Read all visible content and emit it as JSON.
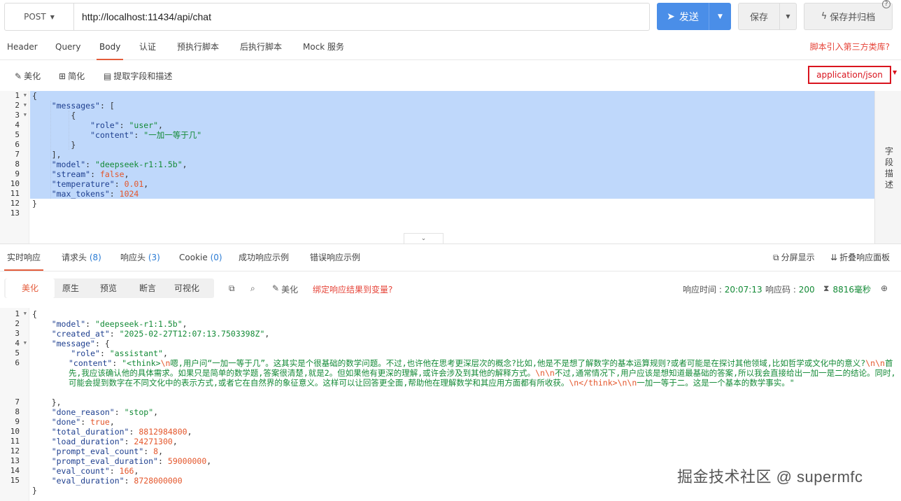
{
  "topbar": {
    "method": "POST",
    "url": "http://localhost:11434/api/chat",
    "send_label": "发送",
    "save_label": "保存",
    "save_archive_label": "保存并归档",
    "help": "?"
  },
  "request_tabs": [
    "Header",
    "Query",
    "Body",
    "认证",
    "预执行脚本",
    "后执行脚本",
    "Mock 服务"
  ],
  "active_request_tab": "Body",
  "third_party_link": "脚本引入第三方类库?",
  "body_tools": {
    "beautify": "美化",
    "simplify": "简化",
    "extract": "提取字段和描述",
    "content_type": "application/json"
  },
  "side_panel_label": "字段描述",
  "request_line_numbers": [
    "1",
    "2",
    "3",
    "4",
    "5",
    "6",
    "7",
    "8",
    "9",
    "10",
    "11",
    "12",
    "13"
  ],
  "request_body": {
    "role_key": "\"role\"",
    "role_val": "\"user\"",
    "content_key": "\"content\"",
    "content_val": "\"一加一等于几\"",
    "messages_key": "\"messages\"",
    "model_key": "\"model\"",
    "model_val": "\"deepseek-r1:1.5b\"",
    "stream_key": "\"stream\"",
    "stream_val": "false",
    "temperature_key": "\"temperature\"",
    "temperature_val": "0.01",
    "max_tokens_key": "\"max_tokens\"",
    "max_tokens_val": "1024"
  },
  "response_tabs": {
    "realtime": "实时响应",
    "req_headers": "请求头",
    "req_headers_count": "(8)",
    "resp_headers": "响应头",
    "resp_headers_count": "(3)",
    "cookie": "Cookie",
    "cookie_count": "(0)",
    "success_example": "成功响应示例",
    "error_example": "错误响应示例",
    "split_view": "分屏显示",
    "fold_panel": "折叠响应面板"
  },
  "response_tools": {
    "segments": [
      "美化",
      "原生",
      "预览",
      "断言",
      "可视化"
    ],
    "active_segment": "美化",
    "beautify": "美化",
    "bind_var": "绑定响应结果到变量?",
    "time_label": "响应时间 : ",
    "time_value": "20:07:13",
    "code_label": "响应码 : ",
    "code_value": "200",
    "duration": "8816毫秒"
  },
  "response_line_numbers": [
    "1",
    "2",
    "3",
    "4",
    "5",
    "6",
    "7",
    "8",
    "9",
    "10",
    "11",
    "12",
    "13",
    "14",
    "15"
  ],
  "response_body": {
    "model_key": "\"model\"",
    "model_val": "\"deepseek-r1:1.5b\"",
    "created_key": "\"created_at\"",
    "created_val": "\"2025-02-27T12:07:13.7503398Z\"",
    "message_key": "\"message\"",
    "role_key": "\"role\"",
    "role_val": "\"assistant\"",
    "content_key": "\"content\"",
    "content_p1": "\"<think>",
    "content_e1": "\\n",
    "content_p2": "嗯,用户问“一加一等于几”。这其实是个很基础的数学问题。不过,也许他在思考更深层次的概念?比如,他是不是想了解数字的基本运算规则?或者可能是在探讨其他领域,比如哲学或文化中的意义?",
    "content_e2": "\\n\\n",
    "content_p3": "首先,我应该确认他的具体需求。如果只是简单的数学题,答案很清楚,就是2。但如果他有更深的理解,或许会涉及到其他的解释方式。",
    "content_e3": "\\n\\n",
    "content_p4": "不过,通常情况下,用户应该是想知道最基础的答案,所以我会直接给出一加一是二的结论。同时,可能会提到数字在不同文化中的表示方式,或者它在自然界的象征意义。这样可以让回答更全面,帮助他在理解数学和其应用方面都有所收获。",
    "content_e4": "\\n</think>\\n\\n",
    "content_p5": "一加一等于二。这是一个基本的数学事实。\"",
    "done_reason_key": "\"done_reason\"",
    "done_reason_val": "\"stop\"",
    "done_key": "\"done\"",
    "done_val": "true",
    "total_duration_key": "\"total_duration\"",
    "total_duration_val": "8812984800",
    "load_duration_key": "\"load_duration\"",
    "load_duration_val": "24271300",
    "prompt_eval_count_key": "\"prompt_eval_count\"",
    "prompt_eval_count_val": "8",
    "prompt_eval_duration_key": "\"prompt_eval_duration\"",
    "prompt_eval_duration_val": "59000000",
    "eval_count_key": "\"eval_count\"",
    "eval_count_val": "166",
    "eval_duration_key": "\"eval_duration\"",
    "eval_duration_val": "8728000000"
  },
  "watermark": "掘金技术社区 @ supermfc",
  "colors": {
    "accent": "#e45c3b",
    "send_button": "#4a8ee8",
    "selection": "#bfd8fb",
    "json_key": "#1e3f8f",
    "json_string": "#138a36",
    "json_number": "#e4562b",
    "content_type_border": "#d9141e"
  }
}
